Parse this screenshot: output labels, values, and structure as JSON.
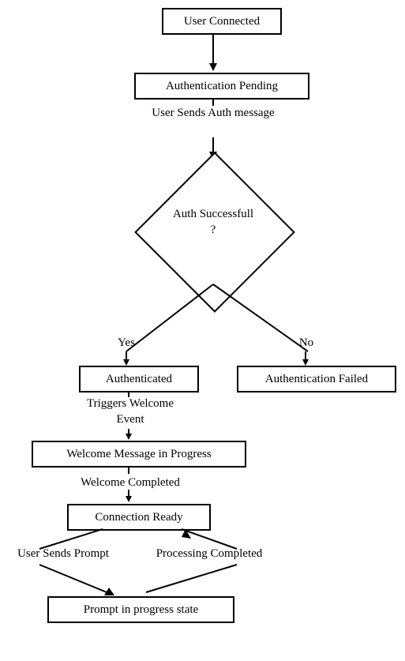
{
  "nodes": {
    "user_connected": "User Connected",
    "auth_pending": "Authentication Pending",
    "auth_success_q": "Auth Successfull ?",
    "authenticated": "Authenticated",
    "auth_failed": "Authentication Failed",
    "welcome_progress": "Welcome Message in Progress",
    "connection_ready": "Connection Ready",
    "prompt_progress": "Prompt in progress state"
  },
  "edges": {
    "sends_auth": "User Sends Auth message",
    "yes": "Yes",
    "no": "No",
    "triggers_welcome": "Triggers Welcome Event",
    "welcome_completed": "Welcome Completed",
    "sends_prompt": "User Sends Prompt",
    "processing_completed": "Processing Completed"
  }
}
